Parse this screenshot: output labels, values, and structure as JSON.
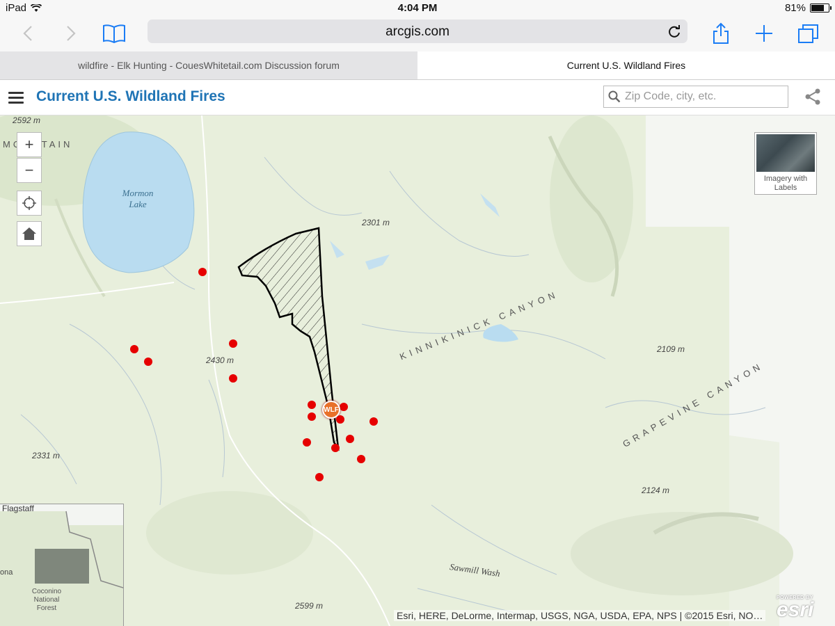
{
  "status_bar": {
    "device": "iPad",
    "time": "4:04 PM",
    "battery": "81%",
    "battery_level": 0.81
  },
  "browser": {
    "url": "arcgis.com",
    "tabs": [
      {
        "label": "wildfire - Elk Hunting - CouesWhitetail.com Discussion forum",
        "active": false
      },
      {
        "label": "Current U.S. Wildland Fires",
        "active": true
      }
    ],
    "icons": [
      "back-icon",
      "forward-icon",
      "bookmarks-icon",
      "reload-icon",
      "share-icon",
      "new-tab-icon",
      "tabs-icon"
    ]
  },
  "app": {
    "title": "Current U.S. Wildland Fires",
    "search_placeholder": "Zip Code, city, etc."
  },
  "map": {
    "zoom_in": "+",
    "zoom_out": "−",
    "basemap_label": "Imagery with Labels",
    "elevations": [
      "2592 m",
      "2301 m",
      "2430 m",
      "2331 m",
      "2109 m",
      "2124 m",
      "2599 m"
    ],
    "features": {
      "lake": "Mormon Lake",
      "canyon1": "KINNIKINICK CANYON",
      "canyon2": "GRAPEVINE CANYON",
      "wash": "Sawmill Wash",
      "mountain_fragment": "MOUNTAIN"
    },
    "fire_marker_label": "WLF",
    "overview": {
      "city": "Flagstaff",
      "forest": "Coconino National Forest",
      "fragment": "ona"
    },
    "attribution": "Esri, HERE, DeLorme, Intermap, USGS, NGA, USDA, EPA, NPS | ©2015 Esri, NO…",
    "logo_powered": "POWERED BY",
    "logo_name": "esri",
    "colors": {
      "fire_dot": "#e60000",
      "title": "#1f74b5",
      "lake": "#b9dcf0",
      "land": "#e8efdc"
    }
  }
}
